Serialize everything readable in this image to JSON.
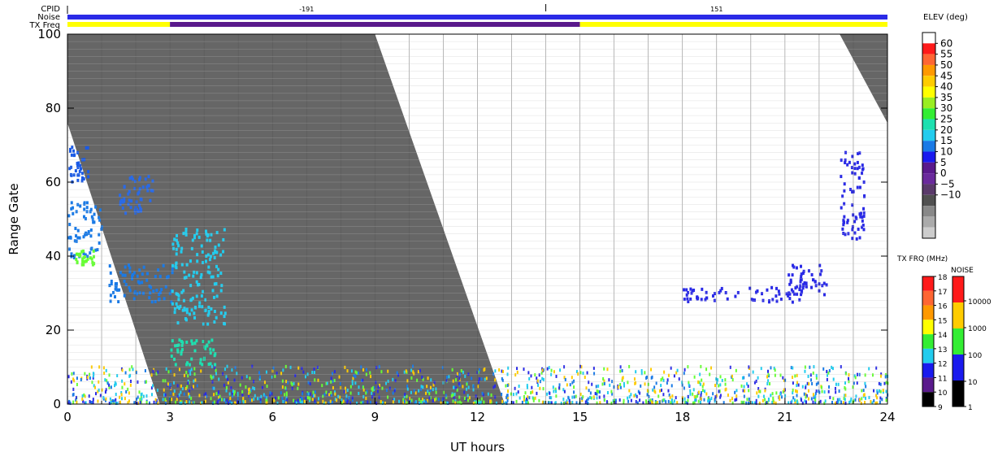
{
  "header": {
    "cpid_label": "CPID",
    "noise_label": "Noise",
    "txfreq_label": "TX Freq",
    "cpid_values": [
      {
        "value": "-191",
        "start": 0,
        "end": 14
      },
      {
        "value": "151",
        "start": 14,
        "end": 24
      }
    ],
    "txfreq_segments": [
      {
        "start": 0,
        "end": 3,
        "color": "#ffff00"
      },
      {
        "start": 3,
        "end": 15,
        "color": "#5a1a8c"
      },
      {
        "start": 15,
        "end": 24,
        "color": "#ffff00"
      }
    ],
    "noise_color": "#2a2ae6"
  },
  "chart_data": {
    "type": "heatmap",
    "xlabel": "UT hours",
    "ylabel": "Range Gate",
    "xlim": [
      0,
      24
    ],
    "ylim": [
      0,
      100
    ],
    "xticks": [
      0,
      3,
      6,
      9,
      12,
      15,
      18,
      21,
      24
    ],
    "yticks": [
      0,
      20,
      40,
      60,
      80,
      100
    ],
    "grid": {
      "vertical_every_hours": 1,
      "horizontal_every_gates": 2
    },
    "ground_scatter_regions": [
      {
        "color": "#666666",
        "points": [
          [
            0,
            100
          ],
          [
            9.0,
            100
          ],
          [
            12.8,
            0
          ],
          [
            2.7,
            0
          ],
          [
            0,
            76
          ]
        ]
      },
      {
        "color": "#666666",
        "points": [
          [
            22.6,
            100
          ],
          [
            24,
            100
          ],
          [
            24,
            76
          ]
        ]
      }
    ],
    "patches": [
      {
        "color": "#1a5ae6",
        "x": [
          0,
          0.6
        ],
        "y": [
          60,
          70
        ]
      },
      {
        "color": "#1a7ae6",
        "x": [
          0,
          1.0
        ],
        "y": [
          40,
          55
        ]
      },
      {
        "color": "#66ff33",
        "x": [
          0.2,
          0.8
        ],
        "y": [
          38,
          42
        ]
      },
      {
        "color": "#2a6ae6",
        "x": [
          1.5,
          2.5
        ],
        "y": [
          52,
          62
        ]
      },
      {
        "color": "#1a7ae6",
        "x": [
          1.2,
          3.1
        ],
        "y": [
          28,
          38
        ]
      },
      {
        "color": "#22ccee",
        "x": [
          3.0,
          4.6
        ],
        "y": [
          22,
          48
        ]
      },
      {
        "color": "#1de0b0",
        "x": [
          3.0,
          4.3
        ],
        "y": [
          11,
          18
        ]
      },
      {
        "color": "#2a2ae6",
        "x": [
          22.6,
          23.3
        ],
        "y": [
          45,
          70
        ]
      },
      {
        "color": "#2a2ae6",
        "x": [
          18.0,
          21.5
        ],
        "y": [
          28,
          32
        ]
      },
      {
        "color": "#2a2ae6",
        "x": [
          21.0,
          22.2
        ],
        "y": [
          30,
          38
        ]
      }
    ],
    "near_range_band": {
      "x": [
        0,
        24
      ],
      "y": [
        0,
        10
      ],
      "colors": [
        "#22ccee",
        "#66ff33",
        "#2a2ae6",
        "#1a7ae6",
        "#ffcc00"
      ]
    }
  },
  "elev_colorbar": {
    "title": "ELEV (deg)",
    "labels": [
      "60",
      "55",
      "50",
      "45",
      "40",
      "35",
      "30",
      "25",
      "20",
      "15",
      "10",
      "5",
      "0",
      "−5",
      "−10"
    ],
    "colors": [
      "#ffffff",
      "#ff1a1a",
      "#ff6633",
      "#ff9900",
      "#ffcc00",
      "#ffff00",
      "#99ee22",
      "#33ee33",
      "#1de0b0",
      "#22ccee",
      "#1a7ae6",
      "#1a1aee",
      "#5a1a8c",
      "#6a2a9c",
      "#5a3a6a",
      "#505050",
      "#888888",
      "#aaaaaa",
      "#cccccc"
    ]
  },
  "txfreq_colorbar": {
    "title": "TX FRQ (MHz)",
    "labels": [
      "18",
      "17",
      "16",
      "15",
      "14",
      "13",
      "12",
      "11",
      "10",
      "9"
    ],
    "colors": [
      "#ff1a1a",
      "#ff6633",
      "#ff9900",
      "#ffff00",
      "#33ee33",
      "#22ccee",
      "#1a1aee",
      "#5a1a8c",
      "#000000"
    ]
  },
  "noise_colorbar": {
    "title": "NOISE",
    "labels": [
      "10000",
      "1000",
      "100",
      "10",
      "1"
    ],
    "colors": [
      "#ff1a1a",
      "#ffcc00",
      "#33ee33",
      "#1a1aee",
      "#000000"
    ]
  }
}
